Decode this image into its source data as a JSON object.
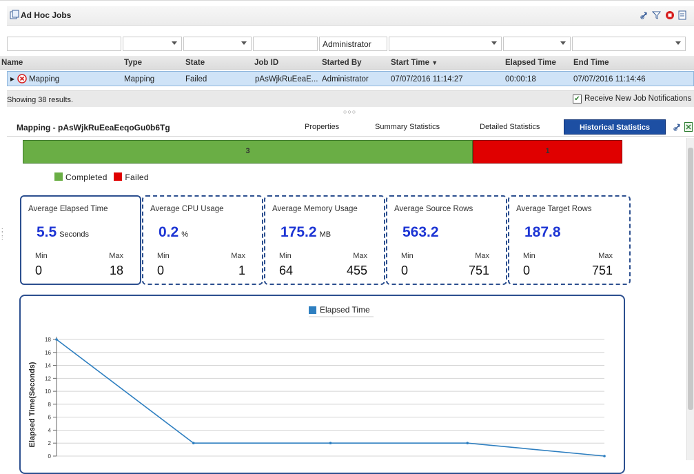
{
  "top_panel": {
    "title": "Ad Hoc Jobs",
    "icons": [
      "refresh-icon",
      "filter-icon",
      "stop-icon",
      "export-icon"
    ],
    "filters": [
      {
        "value": "",
        "dropdown": false
      },
      {
        "value": "",
        "dropdown": true
      },
      {
        "value": "",
        "dropdown": true
      },
      {
        "value": "",
        "dropdown": false
      },
      {
        "value": "Administrator",
        "dropdown": false
      },
      {
        "value": "",
        "dropdown": true
      },
      {
        "value": "",
        "dropdown": true
      },
      {
        "value": "",
        "dropdown": true
      }
    ],
    "columns": [
      "Name",
      "Type",
      "State",
      "Job ID",
      "Started By",
      "Start Time",
      "Elapsed Time",
      "End Time"
    ],
    "sort_column": "Start Time",
    "sort_direction": "descending",
    "rows": [
      {
        "name": "Mapping",
        "type": "Mapping",
        "state": "Failed",
        "job_id": "pAsWjkRuEeaE...",
        "started_by": "Administrator",
        "start_time": "07/07/2016 11:14:27",
        "elapsed_time": "00:00:18",
        "end_time": "07/07/2016 11:14:46",
        "status_icon": "failed-icon",
        "selected": true
      }
    ],
    "showing_text": "Showing 38 results.",
    "notifications_label": "Receive New Job Notifications",
    "notifications_checked": true,
    "splitter": "○○○"
  },
  "detail": {
    "title": "Mapping - pAsWjkRuEeaEeqoGu0b6Tg",
    "tabs": [
      "Properties",
      "Summary Statistics",
      "Detailed Statistics",
      "Historical Statistics"
    ],
    "active_tab": "Historical Statistics"
  },
  "status_bar": {
    "completed": 3,
    "failed": 1,
    "legend": [
      "Completed",
      "Failed"
    ],
    "colors": {
      "completed": "#6aae45",
      "failed": "#e00000"
    }
  },
  "stats": [
    {
      "title": "Average Elapsed Time",
      "value": "5.5",
      "unit": "Seconds",
      "min_label": "Min",
      "max_label": "Max",
      "min": "0",
      "max": "18"
    },
    {
      "title": "Average CPU Usage",
      "value": "0.2",
      "unit": "%",
      "min_label": "Min",
      "max_label": "Max",
      "min": "0",
      "max": "1"
    },
    {
      "title": "Average Memory Usage",
      "value": "175.2",
      "unit": "MB",
      "min_label": "Min",
      "max_label": "Max",
      "min": "64",
      "max": "455"
    },
    {
      "title": "Average Source Rows",
      "value": "563.2",
      "unit": "",
      "min_label": "Min",
      "max_label": "Max",
      "min": "0",
      "max": "751"
    },
    {
      "title": "Average Target Rows",
      "value": "187.8",
      "unit": "",
      "min_label": "Min",
      "max_label": "Max",
      "min": "0",
      "max": "751"
    }
  ],
  "chart_data": {
    "type": "line",
    "legend": "Elapsed Time",
    "ylabel": "Elapsed Time(Seconds)",
    "xlabel": "",
    "yticks": [
      0,
      2,
      4,
      6,
      8,
      10,
      12,
      14,
      16,
      18
    ],
    "ylim": [
      0,
      18
    ],
    "series": [
      {
        "name": "Elapsed Time",
        "values": [
          18,
          2,
          2,
          2,
          0
        ],
        "color": "#2e7fc0"
      }
    ],
    "grid": true
  }
}
